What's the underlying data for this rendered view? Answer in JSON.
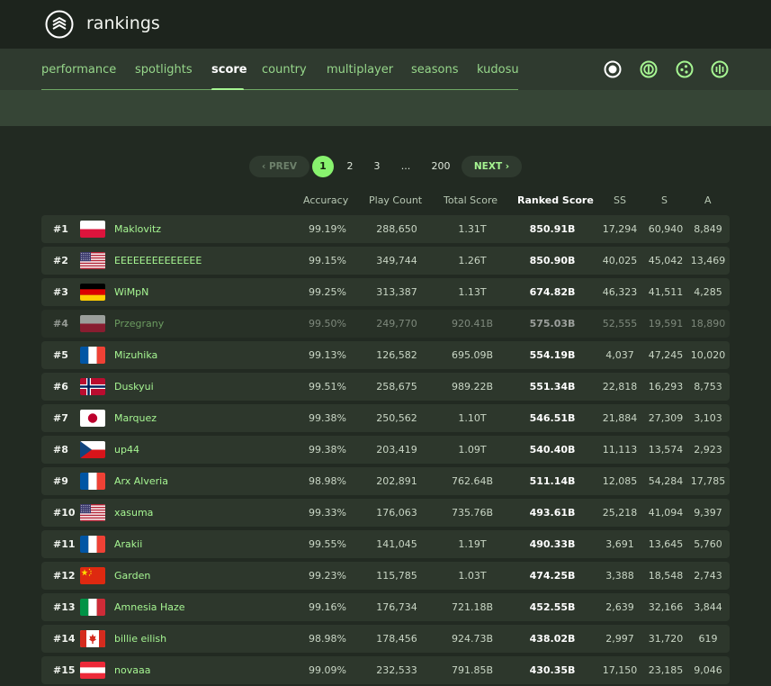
{
  "app": {
    "title": "rankings"
  },
  "nav": {
    "tabs": [
      {
        "label": "performance"
      },
      {
        "label": "spotlights"
      },
      {
        "label": "score"
      },
      {
        "label": "country"
      },
      {
        "label": "multiplayer"
      },
      {
        "label": "seasons"
      },
      {
        "label": "kudosu"
      }
    ],
    "active_tab": "score",
    "modes": [
      "osu-mode-icon",
      "taiko-mode-icon",
      "catch-mode-icon",
      "mania-mode-icon"
    ]
  },
  "pagination": {
    "prev": "PREV",
    "next": "NEXT",
    "pages": [
      "1",
      "2",
      "3",
      "...",
      "200"
    ],
    "current": "1"
  },
  "columns": {
    "accuracy": "Accuracy",
    "play_count": "Play Count",
    "total_score": "Total Score",
    "ranked_score": "Ranked Score",
    "ss": "SS",
    "s": "S",
    "a": "A"
  },
  "rows": [
    {
      "rank": "#1",
      "flag": "poland-flag-icon",
      "name": "Maklovitz",
      "accuracy": "99.19%",
      "play_count": "288,650",
      "total_score": "1.31T",
      "ranked_score": "850.91B",
      "ss": "17,294",
      "s": "60,940",
      "a": "8,849"
    },
    {
      "rank": "#2",
      "flag": "usa-flag-icon",
      "name": "EEEEEEEEEEEEEE",
      "accuracy": "99.15%",
      "play_count": "349,744",
      "total_score": "1.26T",
      "ranked_score": "850.90B",
      "ss": "40,025",
      "s": "45,042",
      "a": "13,469"
    },
    {
      "rank": "#3",
      "flag": "germany-flag-icon",
      "name": "WiMpN",
      "accuracy": "99.25%",
      "play_count": "313,387",
      "total_score": "1.13T",
      "ranked_score": "674.82B",
      "ss": "46,323",
      "s": "41,511",
      "a": "4,285"
    },
    {
      "rank": "#4",
      "flag": "poland-flag-icon",
      "name": "Przegrany",
      "accuracy": "99.50%",
      "play_count": "249,770",
      "total_score": "920.41B",
      "ranked_score": "575.03B",
      "ss": "52,555",
      "s": "19,591",
      "a": "18,890"
    },
    {
      "rank": "#5",
      "flag": "france-flag-icon",
      "name": "Mizuhika",
      "accuracy": "99.13%",
      "play_count": "126,582",
      "total_score": "695.09B",
      "ranked_score": "554.19B",
      "ss": "4,037",
      "s": "47,245",
      "a": "10,020"
    },
    {
      "rank": "#6",
      "flag": "norway-flag-icon",
      "name": "Duskyui",
      "accuracy": "99.51%",
      "play_count": "258,675",
      "total_score": "989.22B",
      "ranked_score": "551.34B",
      "ss": "22,818",
      "s": "16,293",
      "a": "8,753"
    },
    {
      "rank": "#7",
      "flag": "japan-flag-icon",
      "name": "Marquez",
      "accuracy": "99.38%",
      "play_count": "250,562",
      "total_score": "1.10T",
      "ranked_score": "546.51B",
      "ss": "21,884",
      "s": "27,309",
      "a": "3,103"
    },
    {
      "rank": "#8",
      "flag": "czech-flag-icon",
      "name": "up44",
      "accuracy": "99.38%",
      "play_count": "203,419",
      "total_score": "1.09T",
      "ranked_score": "540.40B",
      "ss": "11,113",
      "s": "13,574",
      "a": "2,923"
    },
    {
      "rank": "#9",
      "flag": "france-flag-icon",
      "name": "Arx Alveria",
      "accuracy": "98.98%",
      "play_count": "202,891",
      "total_score": "762.64B",
      "ranked_score": "511.14B",
      "ss": "12,085",
      "s": "54,284",
      "a": "17,785"
    },
    {
      "rank": "#10",
      "flag": "usa-flag-icon",
      "name": "xasuma",
      "accuracy": "99.33%",
      "play_count": "176,063",
      "total_score": "735.76B",
      "ranked_score": "493.61B",
      "ss": "25,218",
      "s": "41,094",
      "a": "9,397"
    },
    {
      "rank": "#11",
      "flag": "france-flag-icon",
      "name": "Arakii",
      "accuracy": "99.55%",
      "play_count": "141,045",
      "total_score": "1.19T",
      "ranked_score": "490.33B",
      "ss": "3,691",
      "s": "13,645",
      "a": "5,760"
    },
    {
      "rank": "#12",
      "flag": "china-flag-icon",
      "name": "Garden",
      "accuracy": "99.23%",
      "play_count": "115,785",
      "total_score": "1.03T",
      "ranked_score": "474.25B",
      "ss": "3,388",
      "s": "18,548",
      "a": "2,743"
    },
    {
      "rank": "#13",
      "flag": "italy-flag-icon",
      "name": "Amnesia Haze",
      "accuracy": "99.16%",
      "play_count": "176,734",
      "total_score": "721.18B",
      "ranked_score": "452.55B",
      "ss": "2,639",
      "s": "32,166",
      "a": "3,844"
    },
    {
      "rank": "#14",
      "flag": "canada-flag-icon",
      "name": "billie eilish",
      "accuracy": "98.98%",
      "play_count": "178,456",
      "total_score": "924.73B",
      "ranked_score": "438.02B",
      "ss": "2,997",
      "s": "31,720",
      "a": "619"
    },
    {
      "rank": "#15",
      "flag": "austria-flag-icon",
      "name": "novaaa",
      "accuracy": "99.09%",
      "play_count": "232,533",
      "total_score": "791.85B",
      "ranked_score": "430.35B",
      "ss": "17,150",
      "s": "23,185",
      "a": "9,046"
    }
  ],
  "inactive_ranks": [
    "#4"
  ],
  "colors": {
    "accent": "#a6f592",
    "active_page": "#88f26e",
    "background": "#222a22",
    "row": "#2d372c",
    "nav": "#2f3a2f"
  }
}
